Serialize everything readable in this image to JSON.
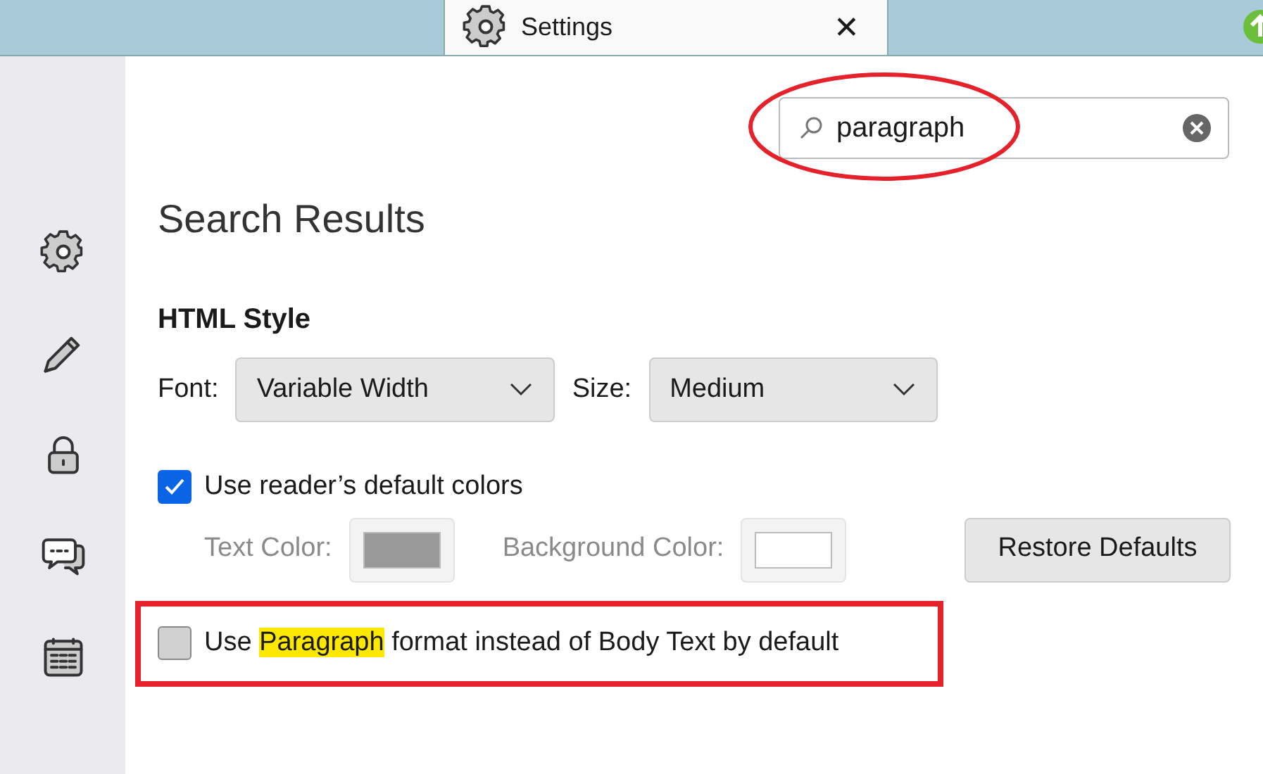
{
  "tab": {
    "title": "Settings",
    "close": "✕"
  },
  "search": {
    "value": "paragraph"
  },
  "heading": "Search Results",
  "section": {
    "title": "HTML Style",
    "font": {
      "label": "Font:",
      "value": "Variable Width"
    },
    "size": {
      "label": "Size:",
      "value": "Medium"
    },
    "reader_colors": {
      "label": "Use reader’s default colors",
      "checked": true
    },
    "colors": [
      {
        "label": "Text Color:",
        "color": "#999999",
        "disabled": true
      },
      {
        "label": "Background Color:",
        "color": "#ffffff",
        "disabled": true
      }
    ],
    "restore": "Restore Defaults",
    "paragraph": {
      "before": "Use ",
      "match": "Paragraph",
      "after": " format instead of Body Text by default",
      "checked": false
    }
  }
}
